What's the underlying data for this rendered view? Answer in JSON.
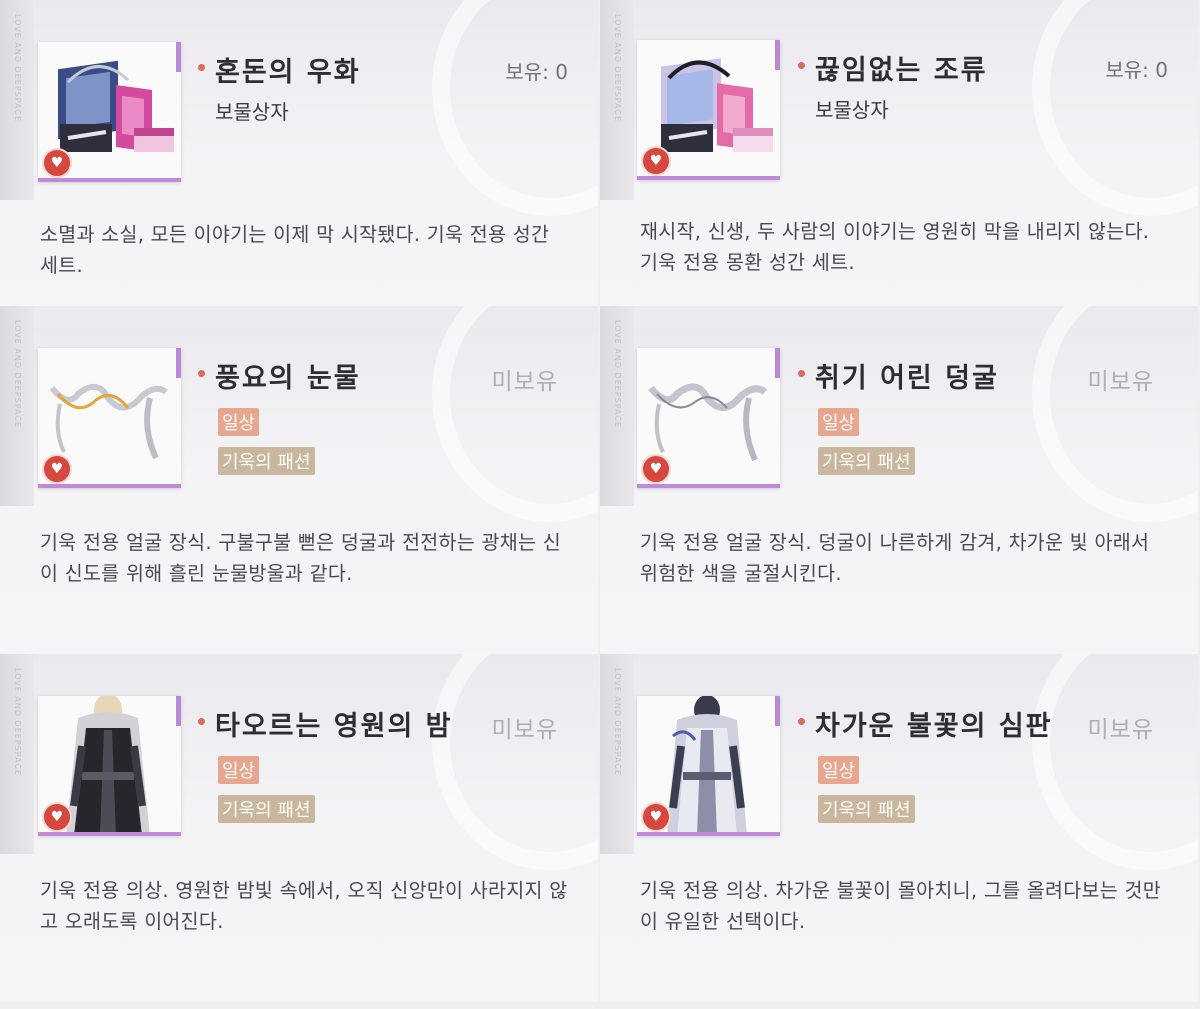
{
  "colors": {
    "background": "#efeef1",
    "bullet": "#d86b5a",
    "tag_daily": "#e7a68d",
    "tag_fashion": "#c9b69c",
    "frame_accent": "#c28ad6",
    "rank_badge": "#d6483e"
  },
  "side_text": "LOVE AND DEEPSPACE",
  "items": [
    {
      "name": "혼돈의 우화",
      "owned": "보유: 0",
      "type": "보물상자",
      "tags": [],
      "description": "소멸과 소실, 모든 이야기는 이제 막 시작됐다. 기욱 전용 성간 세트.",
      "icon": "gift-box-set-icon"
    },
    {
      "name": "끊임없는 조류",
      "owned": "보유: 0",
      "type": "보물상자",
      "tags": [],
      "description": "재시작, 신생, 두 사람의 이야기는 영원히 막을 내리지 않는다. 기욱 전용 몽환 성간 세트.",
      "icon": "gift-box-set-icon"
    },
    {
      "name": "풍요의 눈물",
      "owned": "미보유",
      "type": "",
      "tags": [
        "일상",
        "기욱의 패션"
      ],
      "description": "기욱 전용 얼굴 장식. 구불구불 뻗은 덩굴과 전전하는 광채는 신이 신도를 위해 흘린 눈물방울과 같다.",
      "icon": "face-ornament-icon"
    },
    {
      "name": "취기 어린 덩굴",
      "owned": "미보유",
      "type": "",
      "tags": [
        "일상",
        "기욱의 패션"
      ],
      "description": "기욱 전용 얼굴 장식. 덩굴이 나른하게 감겨, 차가운 빛 아래서 위험한 색을 굴절시킨다.",
      "icon": "face-ornament-icon"
    },
    {
      "name": "타오르는 영원의 밤",
      "owned": "미보유",
      "type": "",
      "tags": [
        "일상",
        "기욱의 패션"
      ],
      "description": "기욱 전용 의상. 영원한 밤빛 속에서, 오직 신앙만이 사라지지 않고 오래도록 이어진다.",
      "icon": "outfit-dark-icon"
    },
    {
      "name": "차가운 불꽃의 심판",
      "owned": "미보유",
      "type": "",
      "tags": [
        "일상",
        "기욱의 패션"
      ],
      "description": "기욱 전용 의상. 차가운 불꽃이 몰아치니, 그를 올려다보는 것만이 유일한 선택이다.",
      "icon": "outfit-light-icon"
    }
  ]
}
